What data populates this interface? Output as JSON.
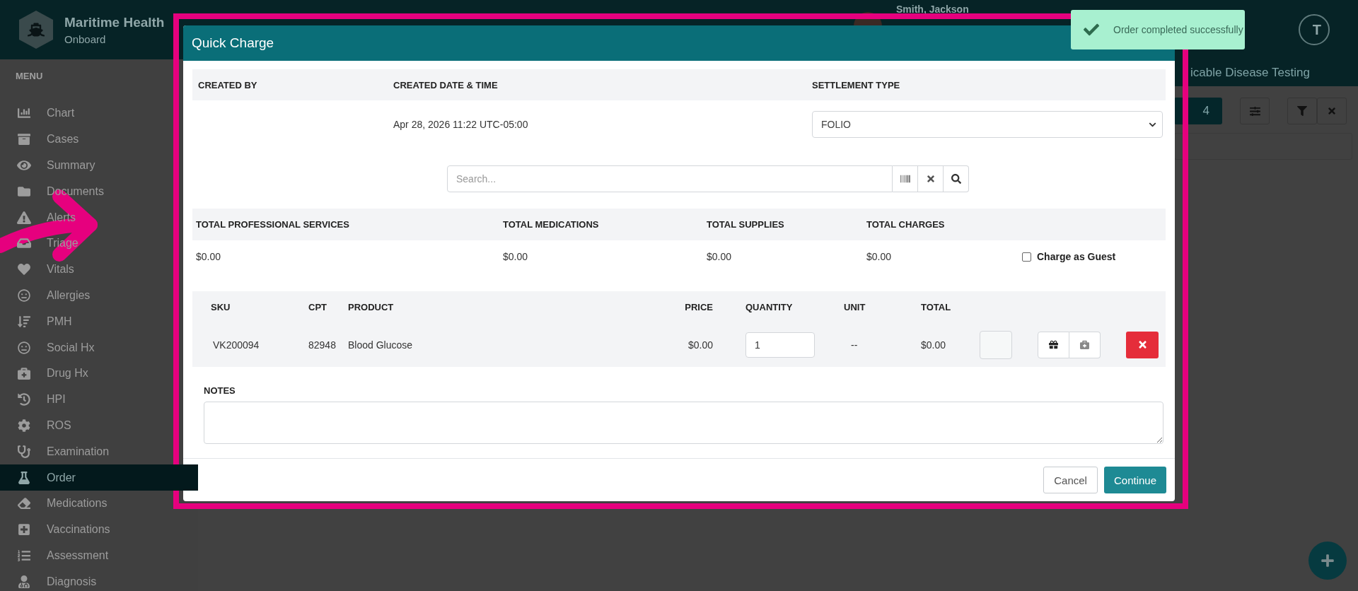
{
  "app": {
    "name": "Maritime Health",
    "subtitle": "Onboard"
  },
  "patient": {
    "name": "Smith, Jackson"
  },
  "user_initial": "T",
  "toast": {
    "message": "Order completed successfully"
  },
  "sidebar": {
    "heading": "MENU",
    "items": [
      {
        "label": "Chart",
        "selected": false
      },
      {
        "label": "Cases",
        "selected": false
      },
      {
        "label": "Summary",
        "selected": false
      },
      {
        "label": "Documents",
        "selected": false
      },
      {
        "label": "Alerts",
        "selected": false
      },
      {
        "label": "Triage",
        "selected": false
      },
      {
        "label": "Vitals",
        "selected": false
      },
      {
        "label": "Allergies",
        "selected": false
      },
      {
        "label": "PMH",
        "selected": false
      },
      {
        "label": "Social Hx",
        "selected": false
      },
      {
        "label": "Drug Hx",
        "selected": false
      },
      {
        "label": "HPI",
        "selected": false
      },
      {
        "label": "ROS",
        "selected": false
      },
      {
        "label": "Examination",
        "selected": false
      },
      {
        "label": "Order",
        "selected": true
      },
      {
        "label": "Medications",
        "selected": false
      },
      {
        "label": "Vaccinations",
        "selected": false
      },
      {
        "label": "Assessment",
        "selected": false
      },
      {
        "label": "Diagnosis",
        "selected": false
      }
    ]
  },
  "background": {
    "tab_title": "icable Disease Testing",
    "page": "4"
  },
  "modal": {
    "title": "Quick Charge",
    "info_columns": [
      "CREATED BY",
      "CREATED DATE & TIME",
      "SETTLEMENT TYPE"
    ],
    "created_at": "Apr 28, 2026 11:22 UTC-05:00",
    "settlement_type": "FOLIO",
    "search": {
      "placeholder": "Search..."
    },
    "totals": [
      {
        "label": "TOTAL PROFESSIONAL SERVICES",
        "value": "$0.00"
      },
      {
        "label": "TOTAL MEDICATIONS",
        "value": "$0.00"
      },
      {
        "label": "TOTAL SUPPLIES",
        "value": "$0.00"
      },
      {
        "label": "TOTAL CHARGES",
        "value": "$0.00"
      }
    ],
    "charge_as_guest": {
      "label": "Charge as Guest",
      "checked": false
    },
    "products": {
      "columns": [
        "SKU",
        "CPT",
        "PRODUCT",
        "PRICE",
        "QUANTITY",
        "UNIT",
        "TOTAL"
      ],
      "rows": [
        {
          "sku": "VK200094",
          "cpt": "82948",
          "product": "Blood Glucose",
          "price": "$0.00",
          "quantity": "1",
          "unit": "--",
          "total": "$0.00"
        }
      ]
    },
    "notes_label": "NOTES",
    "buttons": {
      "cancel": "Cancel",
      "continue": "Continue"
    }
  }
}
